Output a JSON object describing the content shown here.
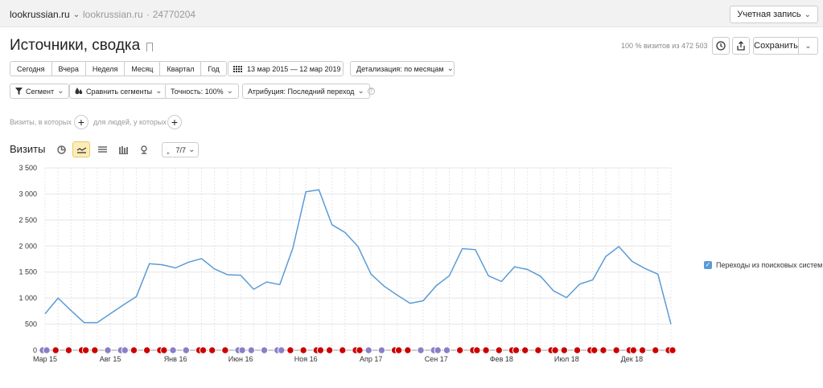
{
  "topbar": {
    "site": "lookrussian.ru",
    "site_secondary": "lookrussian.ru",
    "counter_id": "24770204",
    "account_label": "Учетная запись"
  },
  "header": {
    "title": "Источники, сводка",
    "visits_info": "100 % визитов из 472 503",
    "save_label": "Сохранить"
  },
  "periods": [
    "Сегодня",
    "Вчера",
    "Неделя",
    "Месяц",
    "Квартал",
    "Год"
  ],
  "date_range": "13 мар 2015 — 12 мар 2019",
  "detail_label": "Детализация: по месяцам",
  "toolbar": {
    "segment": "Сегмент",
    "compare": "Сравнить сегменты",
    "accuracy": "Точность: 100%",
    "attribution": "Атрибуция: Последний переход",
    "help": "?"
  },
  "filters": {
    "visits_where": "Визиты, в которых",
    "people_who": "для людей, у которых"
  },
  "chart_section": {
    "title": "Визиты",
    "series_count": "7/7"
  },
  "icons": {
    "accent": "#5b9bd5",
    "event_red": "#cc0000",
    "event_purple": "#8a7fc7"
  },
  "chart_data": {
    "type": "line",
    "x": [
      "Мар 15",
      "Апр 15",
      "Май 15",
      "Июн 15",
      "Июл 15",
      "Авг 15",
      "Сен 15",
      "Окт 15",
      "Ноя 15",
      "Дек 15",
      "Янв 16",
      "Фев 16",
      "Мар 16",
      "Апр 16",
      "Май 16",
      "Июн 16",
      "Июл 16",
      "Авг 16",
      "Сен 16",
      "Окт 16",
      "Ноя 16",
      "Дек 16",
      "Янв 17",
      "Фев 17",
      "Мар 17",
      "Апр 17",
      "Май 17",
      "Июн 17",
      "Июл 17",
      "Авг 17",
      "Сен 17",
      "Окт 17",
      "Ноя 17",
      "Дек 17",
      "Янв 18",
      "Фев 18",
      "Мар 18",
      "Апр 18",
      "Май 18",
      "Июн 18",
      "Июл 18",
      "Авг 18",
      "Сен 18",
      "Окт 18",
      "Ноя 18",
      "Дек 18",
      "Янв 19",
      "Фев 19",
      "Мар 19"
    ],
    "x_ticks": [
      "Мар 15",
      "Авг 15",
      "Янв 16",
      "Июн 16",
      "Ноя 16",
      "Апр 17",
      "Сен 17",
      "Фев 18",
      "Июл 18",
      "Дек 18"
    ],
    "y_ticks": [
      "0",
      "500",
      "1 000",
      "1 500",
      "2 000",
      "2 500",
      "3 000",
      "3 500"
    ],
    "ylim": [
      0,
      3500
    ],
    "grid": true,
    "legend_position": "right",
    "series": [
      {
        "name": "Переходы из поисковых систем",
        "color": "#5b9bd5",
        "values": [
          700,
          1000,
          760,
          530,
          530,
          700,
          870,
          1030,
          1660,
          1640,
          1580,
          1690,
          1760,
          1560,
          1450,
          1440,
          1170,
          1310,
          1260,
          1960,
          3040,
          3080,
          2410,
          2260,
          1990,
          1460,
          1230,
          1060,
          900,
          950,
          1240,
          1430,
          1950,
          1930,
          1430,
          1320,
          1600,
          1550,
          1420,
          1140,
          1010,
          1270,
          1350,
          1800,
          1990,
          1710,
          1570,
          1460,
          500
        ]
      }
    ]
  }
}
